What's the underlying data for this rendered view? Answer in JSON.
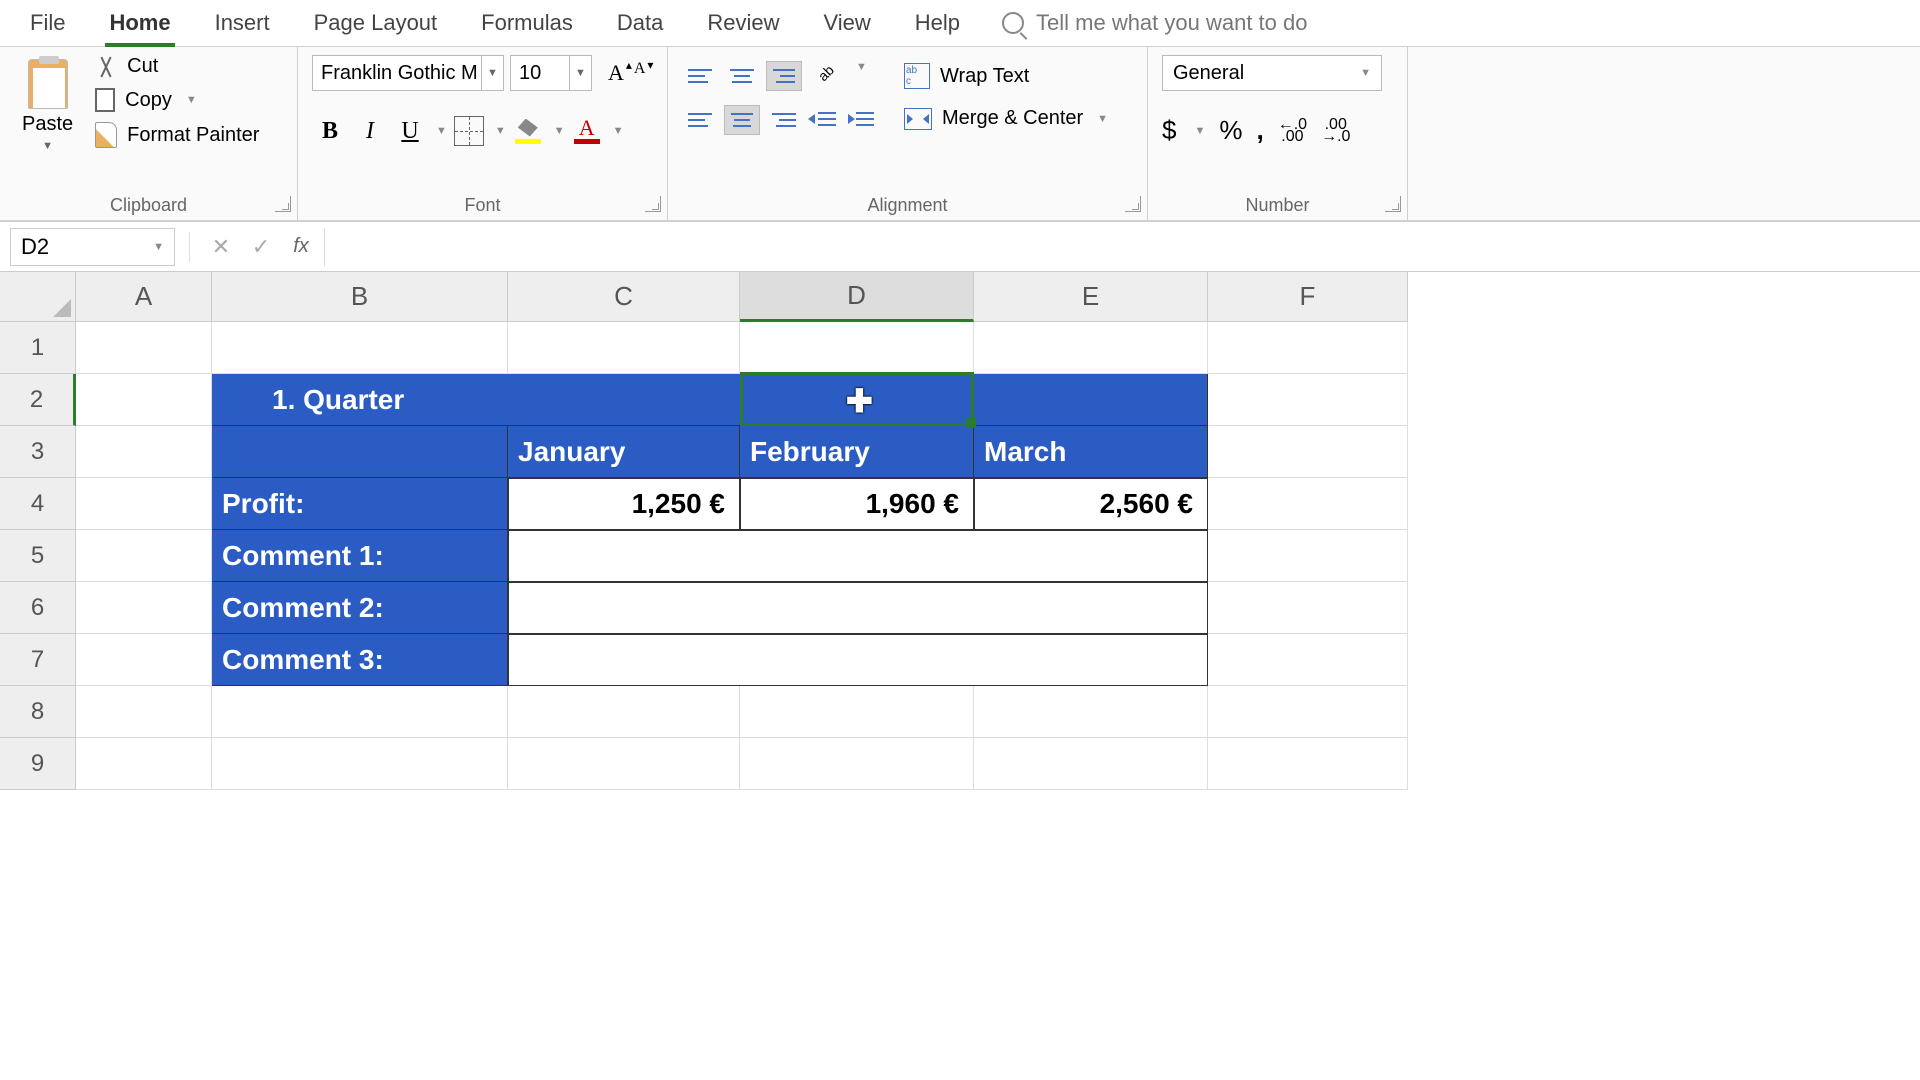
{
  "menu": {
    "items": [
      "File",
      "Home",
      "Insert",
      "Page Layout",
      "Formulas",
      "Data",
      "Review",
      "View",
      "Help"
    ],
    "active": "Home",
    "tell_me": "Tell me what you want to do"
  },
  "ribbon": {
    "clipboard": {
      "paste": "Paste",
      "cut": "Cut",
      "copy": "Copy",
      "format_painter": "Format Painter",
      "label": "Clipboard"
    },
    "font": {
      "name": "Franklin Gothic M",
      "size": "10",
      "label": "Font"
    },
    "alignment": {
      "wrap": "Wrap Text",
      "merge": "Merge & Center",
      "label": "Alignment"
    },
    "number": {
      "format": "General",
      "label": "Number"
    }
  },
  "formula_bar": {
    "name_box": "D2",
    "formula": ""
  },
  "grid": {
    "columns": [
      "A",
      "B",
      "C",
      "D",
      "E",
      "F"
    ],
    "selected_col": "D",
    "rows": [
      "1",
      "2",
      "3",
      "4",
      "5",
      "6",
      "7",
      "8",
      "9"
    ],
    "selected_row": "2",
    "table": {
      "title": "1. Quarter",
      "months": [
        "January",
        "February",
        "March"
      ],
      "profit_label": "Profit:",
      "profit_values": [
        "1,250 €",
        "1,960 €",
        "2,560 €"
      ],
      "comment_labels": [
        "Comment 1:",
        "Comment 2:",
        "Comment 3:"
      ]
    }
  }
}
